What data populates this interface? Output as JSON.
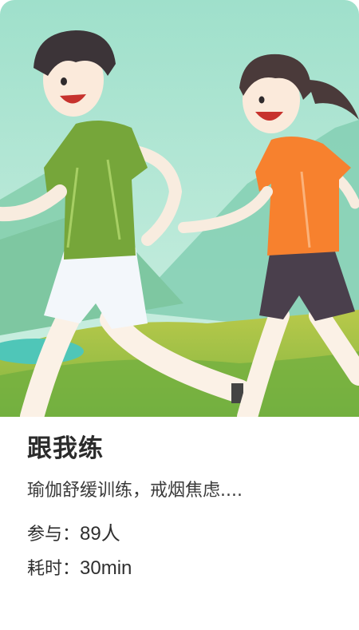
{
  "card": {
    "title": "跟我练",
    "description": "瑜伽舒缓训练，戒烟焦虑....",
    "participants": {
      "label": "参与：",
      "value": "89人"
    },
    "duration": {
      "label": "耗时：",
      "value": "30min"
    }
  },
  "colors": {
    "sky_top": "#a6e3cf",
    "sky_bottom": "#c8eee0",
    "mountain": "#7fd0b2",
    "grass": "#8fc24a",
    "green_shirt": "#78a83a",
    "orange_shirt": "#f7812e",
    "dark_shorts": "#4a3f4c",
    "title_text": "#2b2b2b"
  },
  "hero_illustration": "running-couple-illustration"
}
